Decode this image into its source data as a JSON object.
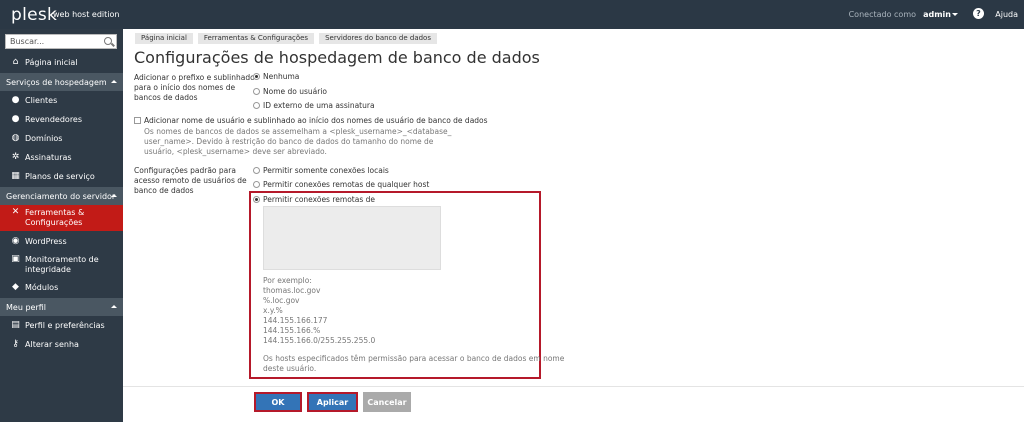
{
  "topbar": {
    "logo": "plesk",
    "edition": "web host edition",
    "connected_as": "Conectado como",
    "user": "admin",
    "help": "Ajuda"
  },
  "sidebar": {
    "search_placeholder": "Buscar...",
    "home": "Página inicial",
    "sections": [
      {
        "title": "Serviços de hospedagem",
        "items": [
          "Clientes",
          "Revendedores",
          "Domínios",
          "Assinaturas",
          "Planos de serviço"
        ]
      },
      {
        "title": "Gerenciamento do servidor",
        "items": [
          "Ferramentas & Configurações",
          "WordPress",
          "Monitoramento de integridade",
          "Módulos"
        ]
      },
      {
        "title": "Meu perfil",
        "items": [
          "Perfil e preferências",
          "Alterar senha"
        ]
      }
    ]
  },
  "breadcrumb": [
    "Página inicial",
    "Ferramentas & Configurações",
    "Servidores do banco de dados"
  ],
  "page_title": "Configurações de hospedagem de banco de dados",
  "form": {
    "prefix_label": [
      "Adicionar o prefixo e sublinhado",
      "para o início dos nomes de",
      "bancos de dados"
    ],
    "prefix_options": [
      "Nenhuma",
      "Nome do usuário",
      "ID externo de uma assinatura"
    ],
    "username_checkbox": "Adicionar nome de usuário e sublinhado ao início dos nomes de usuário de banco de dados",
    "username_hint": [
      "Os nomes de bancos de dados se assemelham a <plesk_username>_<database_",
      "user_name>. Devido à restrição do banco de dados do tamanho do nome de",
      "usuário, <plesk_username> deve ser abreviado."
    ],
    "remote_label": [
      "Configurações padrão para",
      "acesso remoto de usuários de",
      "banco de dados"
    ],
    "remote_options": [
      "Permitir somente conexões locais",
      "Permitir conexões remotas de qualquer host",
      "Permitir conexões remotas de"
    ],
    "hosts_value": "",
    "example_lines": [
      "Por exemplo:",
      "thomas.loc.gov",
      "%.loc.gov",
      "x.y.%",
      "144.155.166.177",
      "144.155.166.%",
      "144.155.166.0/255.255.255.0"
    ],
    "hosts_hint": [
      "Os hosts especificados têm permissão para acessar o banco de dados em nome",
      "deste usuário."
    ]
  },
  "buttons": {
    "ok": "OK",
    "apply": "Aplicar",
    "cancel": "Cancelar"
  }
}
